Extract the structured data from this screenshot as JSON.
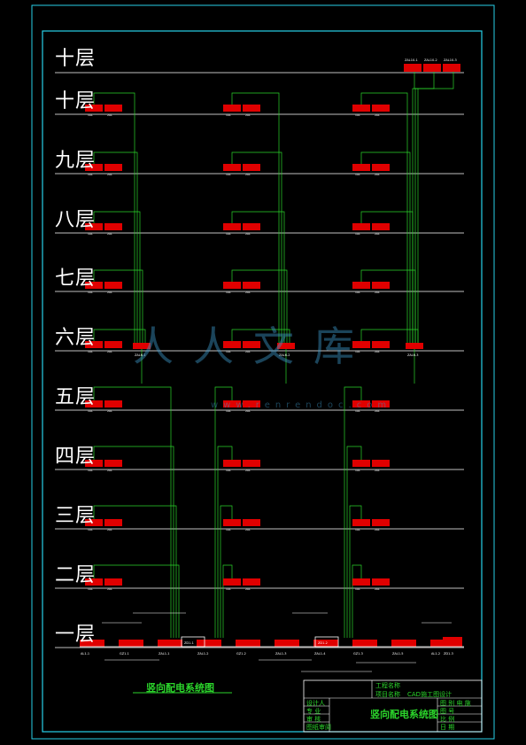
{
  "floors": [
    "十层",
    "十层",
    "九层",
    "八层",
    "七层",
    "六层",
    "五层",
    "四层",
    "三层",
    "二层",
    "一层"
  ],
  "diagram_title": "竖向配电系统图",
  "title_block": {
    "project_label": "工程名称",
    "item_label": "项目名称",
    "item_value": "CAD施工图设计",
    "rows": [
      "设计人",
      "专 业",
      "审 核",
      "图纸审阅"
    ],
    "drawing_title": "竖向配电系统图",
    "right_labels": [
      "图 别 电 施",
      "图 号",
      "比 例",
      "日 期"
    ]
  },
  "box_labels": {
    "top_panel": [
      "ZAL10-1",
      "ZAL10-2",
      "ZAL10-3"
    ],
    "floor_box_pair": [
      "1AL",
      "2AL"
    ],
    "collector_left": "ZAL6-1",
    "collector_mid": "ZAL6-2",
    "collector_right": "ZAL6-3",
    "ground": [
      "AL1-1",
      "GZ1-1",
      "ZAL1-1",
      "ZAL1-2",
      "GZ1-2",
      "ZAL1-3",
      "ZAL1-4",
      "GZ1-3",
      "ZAL1-5",
      "AL1-2"
    ],
    "ground_main": [
      "ZD1-1",
      "ZD1-2",
      "ZD1-3"
    ]
  },
  "watermark": {
    "text": "人人文库",
    "sub": "www.renrendoc.com"
  },
  "colors": {
    "frame": "#27d0e8",
    "line": "#ffffff",
    "wire": "#2bd52b",
    "box": "#e00000",
    "text": "#ffffff"
  }
}
